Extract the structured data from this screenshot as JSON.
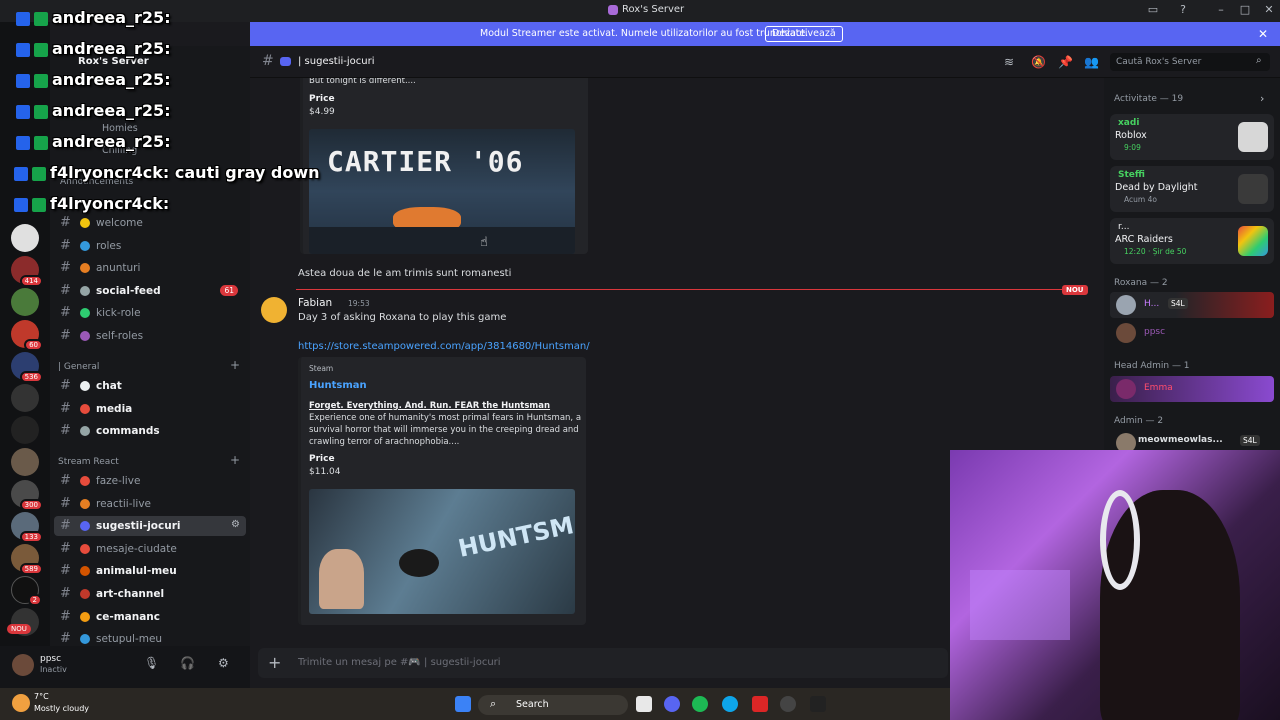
{
  "window": {
    "title": "Rox's Server"
  },
  "banner": {
    "text": "Modul Streamer este activat. Numele utilizatorilor au fost trunchiate.",
    "button": "Dezactivează"
  },
  "server": {
    "name": "Rox's Server"
  },
  "rail_badges": [
    "414",
    "60",
    "536",
    "300",
    "133",
    "589",
    "2",
    "NOU"
  ],
  "sidebar": {
    "top_items": [
      "Homies",
      "Chilling"
    ],
    "top_category": "Announcements",
    "channels_a": [
      {
        "emoji": "#f1c40f",
        "label": "welcome",
        "bright": false
      },
      {
        "emoji": "#3498db",
        "label": "roles",
        "bright": false
      },
      {
        "emoji": "#e67e22",
        "label": "anunturi",
        "bright": false
      },
      {
        "emoji": "#95a5a6",
        "label": "social-feed",
        "bright": true,
        "count": "61"
      },
      {
        "emoji": "#2ecc71",
        "label": "kick-role",
        "bright": false
      },
      {
        "emoji": "#9b59b6",
        "label": "self-roles",
        "bright": false
      }
    ],
    "cat_general": "| General",
    "channels_b": [
      {
        "emoji": "#ecf0f1",
        "label": "chat",
        "bright": true
      },
      {
        "emoji": "#e74c3c",
        "label": "media",
        "bright": true
      },
      {
        "emoji": "#95a5a6",
        "label": "commands",
        "bright": true
      }
    ],
    "cat_stream": "Stream React",
    "channels_c": [
      {
        "emoji": "#e74c3c",
        "label": "faze-live",
        "bright": false
      },
      {
        "emoji": "#e67e22",
        "label": "reactii-live",
        "bright": false
      },
      {
        "emoji": "#5865f2",
        "label": "sugestii-jocuri",
        "bright": true,
        "active": true
      },
      {
        "emoji": "#e74c3c",
        "label": "mesaje-ciudate",
        "bright": false
      },
      {
        "emoji": "#d35400",
        "label": "animalul-meu",
        "bright": true
      },
      {
        "emoji": "#c0392b",
        "label": "art-channel",
        "bright": true
      },
      {
        "emoji": "#f39c12",
        "label": "ce-mananc",
        "bright": true
      },
      {
        "emoji": "#3498db",
        "label": "setupul-meu",
        "bright": false
      }
    ]
  },
  "user": {
    "name": "ppsc",
    "status": "Inactiv"
  },
  "channel_header": {
    "name": "| sugestii-jocuri",
    "search_placeholder": "Caută Rox's Server"
  },
  "messages": {
    "embed1": {
      "snippet": "But tonight is different....",
      "price_label": "Price",
      "price": "$4.99",
      "image_text": "CARTIER '06"
    },
    "msg1": "Astea doua de le am trimis sunt romanesti",
    "divider_badge": "NOU",
    "msg2": {
      "author": "Fabian",
      "time": "19:53",
      "text": "Day 3 of asking Roxana to play this game",
      "link": "https://store.steampowered.com/app/3814680/Huntsman/",
      "embed": {
        "provider": "Steam",
        "title": "Huntsman",
        "subtitle": "Forget. Everything. And. Run. FEAR the Huntsman",
        "desc": [
          "Experience one of humanity's most primal fears in Huntsman, a",
          "survival horror that will immerse you in the creeping dread and",
          "crawling terror of arachnophobia...."
        ],
        "price_label": "Price",
        "price": "$11.04",
        "image_text": "HUNTSMAN"
      }
    }
  },
  "composer": {
    "placeholder": "Trimite un mesaj pe #🎮 | sugestii-jocuri"
  },
  "members": {
    "activity_header": "Activitate — 19",
    "activities": [
      {
        "user": "xadi",
        "game": "Roblox",
        "time": "9:09",
        "color": "#46d160"
      },
      {
        "user": "Steffi",
        "game": "Dead by Daylight",
        "time": "Acum 4o",
        "color": "#46d160"
      },
      {
        "user": "r...",
        "game": "ARC Raiders",
        "time": "12:20 · Șir de 50",
        "color": "#f2f3f5"
      }
    ],
    "roxana_header": "Roxana — 2",
    "roxana": [
      {
        "name": "H...",
        "tag": "S4L",
        "color": "#c77dff"
      },
      {
        "name": "ppsc",
        "tag": "",
        "color": "#9b59b6"
      }
    ],
    "head_admin_header": "Head Admin — 1",
    "head_admin": [
      {
        "name": "Emma",
        "tag": "",
        "color": "#ff4d6d"
      }
    ],
    "admin_header": "Admin — 2",
    "admin": [
      {
        "name": "meowmeowlas...",
        "tag": "S4L",
        "color": "#46d160"
      }
    ]
  },
  "overlay": [
    {
      "user": "andreea_r25:",
      "msg": ""
    },
    {
      "user": "andreea_r25:",
      "msg": ""
    },
    {
      "user": "andreea_r25:",
      "msg": ""
    },
    {
      "user": "andreea_r25:",
      "msg": ""
    },
    {
      "user": "andreea_r25:",
      "msg": ""
    },
    {
      "user": "f4lryoncr4ck:",
      "msg": "cauti gray down"
    },
    {
      "user": "f4lryoncr4ck:",
      "msg": ""
    }
  ],
  "taskbar": {
    "temp": "7°C",
    "weather": "Mostly cloudy",
    "search": "Search"
  }
}
